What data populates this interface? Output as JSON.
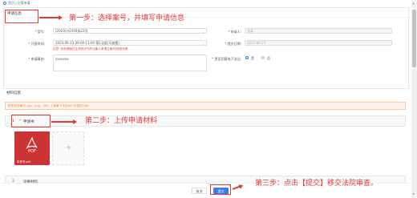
{
  "breadcrumb": {
    "home": "首页",
    "separator": "/",
    "current": "立案申请"
  },
  "apply_section": {
    "title": "申请信息"
  },
  "form": {
    "case_no": {
      "label": "* 案号:",
      "value": "(2023)川0193执23号"
    },
    "applicant": {
      "label": "* 申请人:",
      "value": "张某"
    },
    "exec_time": {
      "label": "* 开庭时间:",
      "value": "2023-06-23 09:00-11:00 第1法庭(可查看)"
    },
    "submit_time": {
      "label": "* 提交日期:",
      "value": "2023-06-23"
    },
    "warning": "注意: 仅申请案件生效判决书的当事人申请立案/时效前申请",
    "reason": {
      "label": "* 申请事由:",
      "value": "xxxxxxx"
    },
    "agree": {
      "label": "* 是否同意电子送达:",
      "yes": "是",
      "no": "否"
    }
  },
  "material_section": {
    "title": "材料信息",
    "tip": "附件支持格式: jpg、png、PDF; 上传单个文件大小不超过10M",
    "group1": {
      "num": "1",
      "req": "*",
      "name": "申请书"
    },
    "file": {
      "type": "PDF",
      "name": "申请书.pdf"
    },
    "add": "+",
    "group2": {
      "num": "2",
      "name": "证据材料"
    }
  },
  "footer": {
    "cancel": "取消",
    "submit": "提交"
  },
  "annotations": {
    "step1": "第一步：选择案号，并填写申请信息",
    "step2": "第二步：上传申请材料",
    "step3": "第三步：点击【提交】移交法院审查。"
  },
  "colors": {
    "accent": "#3a7de6",
    "annotation": "#e53935",
    "file_card": "#cc3333"
  }
}
